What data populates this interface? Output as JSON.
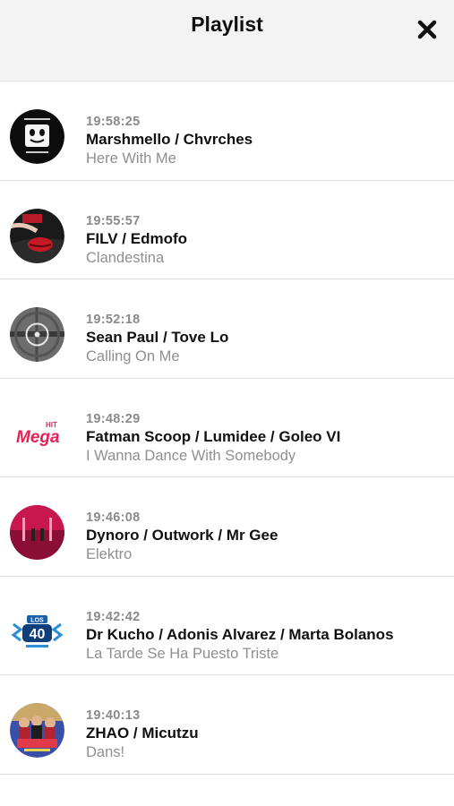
{
  "header": {
    "title": "Playlist",
    "close_icon": "close-icon"
  },
  "tracks": [
    {
      "time": "19:58:25",
      "artist": "Marshmello / Chvrches",
      "song": "Here With Me",
      "cover": "marshmello-cover"
    },
    {
      "time": "19:55:57",
      "artist": "FILV / Edmofo",
      "song": "Clandestina",
      "cover": "red-lips-cover"
    },
    {
      "time": "19:52:18",
      "artist": "Sean Paul / Tove Lo",
      "song": "Calling On Me",
      "cover": "gray-target-cover"
    },
    {
      "time": "19:48:29",
      "artist": "Fatman Scoop / Lumidee / Goleo VI",
      "song": "I Wanna Dance With Somebody",
      "cover": "mega-hit-logo"
    },
    {
      "time": "19:46:08",
      "artist": "Dynoro / Outwork / Mr Gee",
      "song": "Elektro",
      "cover": "pink-room-cover"
    },
    {
      "time": "19:42:42",
      "artist": "Dr Kucho / Adonis Alvarez / Marta Bolanos",
      "song": "La Tarde Se Ha Puesto Triste",
      "cover": "los-40-logo"
    },
    {
      "time": "19:40:13",
      "artist": "ZHAO / Micutzu",
      "song": "Dans!",
      "cover": "dans-cover"
    }
  ],
  "logos": {
    "mega_hit": "Mega HIT",
    "los40": "LOS 40"
  }
}
